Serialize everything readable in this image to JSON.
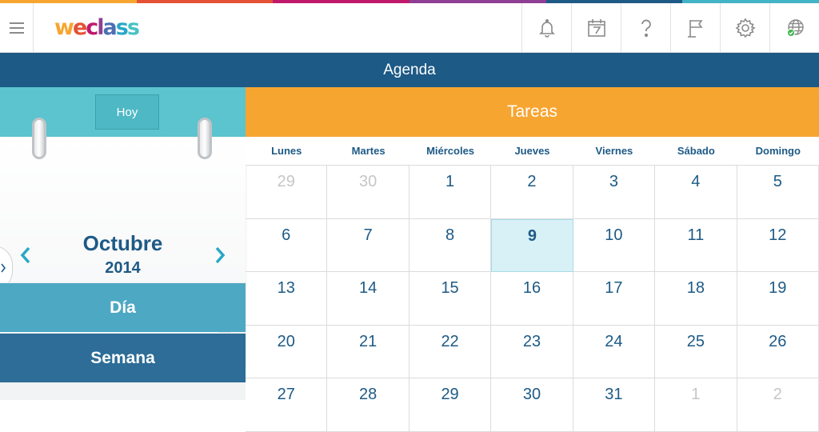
{
  "colors": {
    "header_bar": "#1d5a86",
    "teal": "#5bc4cf",
    "orange": "#f7a531",
    "today_bg": "#d8f1f6",
    "strip": [
      "#f7a531",
      "#e55235",
      "#c0196c",
      "#8e3f93",
      "#1d5a86",
      "#44b3c6"
    ]
  },
  "header": {
    "logo_letters": [
      {
        "char": "w",
        "color": "#f7a531"
      },
      {
        "char": "e",
        "color": "#e55235"
      },
      {
        "char": "c",
        "color": "#c0196c"
      },
      {
        "char": "l",
        "color": "#8e3f93"
      },
      {
        "char": "a",
        "color": "#4c6fb4"
      },
      {
        "char": "s",
        "color": "#2aa7c8"
      },
      {
        "char": "s",
        "color": "#48c2c5"
      }
    ],
    "icons": [
      "bell-icon",
      "calendar-7-icon",
      "help-icon",
      "flag-icon",
      "gear-icon",
      "globe-icon"
    ]
  },
  "title": "Agenda",
  "calendar": {
    "today_label": "Hoy",
    "month": "Octubre",
    "year": "2014",
    "views": {
      "day": "Día",
      "week": "Semana"
    },
    "tasks_label": "Tareas",
    "weekdays": [
      "Lunes",
      "Martes",
      "Miércoles",
      "Jueves",
      "Viernes",
      "Sábado",
      "Domingo"
    ],
    "weeks": [
      [
        {
          "d": "29",
          "muted": true
        },
        {
          "d": "30",
          "muted": true
        },
        {
          "d": "1"
        },
        {
          "d": "2"
        },
        {
          "d": "3"
        },
        {
          "d": "4"
        },
        {
          "d": "5"
        }
      ],
      [
        {
          "d": "6"
        },
        {
          "d": "7"
        },
        {
          "d": "8"
        },
        {
          "d": "9",
          "today": true
        },
        {
          "d": "10"
        },
        {
          "d": "11"
        },
        {
          "d": "12"
        }
      ],
      [
        {
          "d": "13"
        },
        {
          "d": "14"
        },
        {
          "d": "15"
        },
        {
          "d": "16"
        },
        {
          "d": "17"
        },
        {
          "d": "18"
        },
        {
          "d": "19"
        }
      ],
      [
        {
          "d": "20"
        },
        {
          "d": "21"
        },
        {
          "d": "22"
        },
        {
          "d": "23"
        },
        {
          "d": "24"
        },
        {
          "d": "25"
        },
        {
          "d": "26"
        }
      ],
      [
        {
          "d": "27"
        },
        {
          "d": "28"
        },
        {
          "d": "29"
        },
        {
          "d": "30"
        },
        {
          "d": "31"
        },
        {
          "d": "1",
          "muted": true
        },
        {
          "d": "2",
          "muted": true
        }
      ]
    ]
  }
}
